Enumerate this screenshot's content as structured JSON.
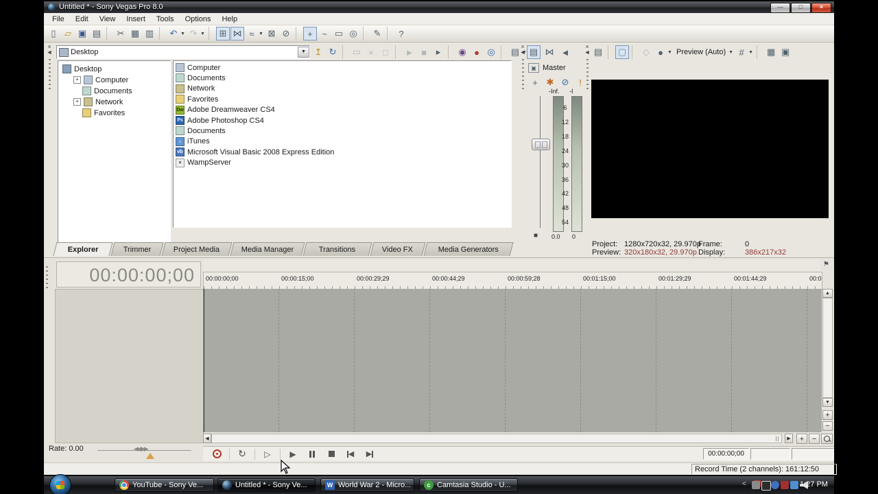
{
  "window": {
    "title": "Untitled * - Sony Vegas Pro 8.0"
  },
  "menu": [
    "File",
    "Edit",
    "View",
    "Insert",
    "Tools",
    "Options",
    "Help"
  ],
  "main_toolbar": [
    {
      "name": "new-project"
    },
    {
      "name": "open"
    },
    {
      "name": "save"
    },
    {
      "name": "project-properties"
    },
    {
      "sep": true
    },
    {
      "name": "cut"
    },
    {
      "name": "copy"
    },
    {
      "name": "paste"
    },
    {
      "sep": true
    },
    {
      "name": "undo",
      "arrow": true
    },
    {
      "name": "redo",
      "arrow": true,
      "disabled": true
    },
    {
      "sep": true
    },
    {
      "name": "enable-snapping",
      "pressed": true
    },
    {
      "name": "automatic-crossfades",
      "pressed": true
    },
    {
      "name": "auto-ripple",
      "arrow": true
    },
    {
      "name": "lock-envelopes"
    },
    {
      "name": "ignore-event-grouping"
    },
    {
      "sep": true
    },
    {
      "name": "normal-edit-tool",
      "pressed": true
    },
    {
      "name": "envelope-edit-tool"
    },
    {
      "name": "selection-edit-tool"
    },
    {
      "name": "zoom-edit-tool"
    },
    {
      "sep": true
    },
    {
      "name": "interactive-tutorials"
    },
    {
      "sep": true
    },
    {
      "name": "whats-this-help"
    }
  ],
  "explorer": {
    "address_value": "Desktop",
    "toolbar": [
      {
        "name": "up-one-level"
      },
      {
        "name": "refresh"
      },
      {
        "sep": true
      },
      {
        "name": "new-folder",
        "disabled": true
      },
      {
        "name": "delete",
        "disabled": true
      },
      {
        "name": "add-to-favorites",
        "disabled": true
      },
      {
        "sep": true
      },
      {
        "name": "start-preview",
        "disabled": true
      },
      {
        "name": "stop-preview",
        "disabled": true
      },
      {
        "name": "auto-preview"
      },
      {
        "sep": true
      },
      {
        "name": "get-media-from-web"
      },
      {
        "name": "media-manager"
      },
      {
        "name": "search-media"
      },
      {
        "sep": true
      },
      {
        "name": "views",
        "arrow": true
      }
    ],
    "tree": [
      {
        "label": "Desktop",
        "level": 0,
        "icon": "desktop",
        "expander": ""
      },
      {
        "label": "Computer",
        "level": 1,
        "icon": "computer",
        "expander": "+"
      },
      {
        "label": "Documents",
        "level": 1,
        "icon": "documents",
        "expander": ""
      },
      {
        "label": "Network",
        "level": 1,
        "icon": "network",
        "expander": "+"
      },
      {
        "label": "Favorites",
        "level": 1,
        "icon": "favorites",
        "expander": ""
      }
    ],
    "files": [
      {
        "label": "Computer",
        "icon": "computer"
      },
      {
        "label": "Documents",
        "icon": "documents"
      },
      {
        "label": "Network",
        "icon": "network"
      },
      {
        "label": "Favorites",
        "icon": "favorites"
      },
      {
        "label": "Adobe Dreamweaver CS4",
        "icon": "dreamweaver"
      },
      {
        "label": "Adobe Photoshop CS4",
        "icon": "photoshop"
      },
      {
        "label": "Documents",
        "icon": "documents"
      },
      {
        "label": "iTunes",
        "icon": "itunes"
      },
      {
        "label": "Microsoft Visual Basic 2008 Express Edition",
        "icon": "visual-basic"
      },
      {
        "label": "WampServer",
        "icon": "wampserver"
      }
    ],
    "tabs": [
      "Explorer",
      "Trimmer",
      "Project Media",
      "Media Manager",
      "Transitions",
      "Video FX",
      "Media Generators"
    ],
    "active_tab": 0
  },
  "mixer": {
    "toolbar": [
      {
        "name": "mixer-properties",
        "pressed": true
      },
      {
        "name": "downmix-output"
      },
      {
        "name": "dim-output"
      }
    ],
    "bus_label": "Master",
    "controls": [
      {
        "name": "insert-fx"
      },
      {
        "name": "bus-settings"
      },
      {
        "name": "mute"
      },
      {
        "name": "solo"
      }
    ],
    "meter": {
      "top_label_left": "-Inf.",
      "top_label_right": "-I",
      "ticks": [
        "6",
        "12",
        "18",
        "24",
        "30",
        "36",
        "42",
        "48",
        "54"
      ],
      "bottom_left": "0.0",
      "bottom_right": "0"
    }
  },
  "preview": {
    "toolbar": [
      {
        "name": "project-video-properties"
      },
      {
        "sep": true
      },
      {
        "name": "external-monitor",
        "pressed": true
      },
      {
        "sep": true
      },
      {
        "name": "video-output-fx",
        "disabled": true
      },
      {
        "name": "preview-quality",
        "arrow": true
      },
      {
        "label": "Preview (Auto)",
        "name": "preview-quality-mode",
        "arrow": true
      },
      {
        "name": "overlays",
        "arrow": true
      },
      {
        "sep": true
      },
      {
        "name": "copy-snapshot"
      },
      {
        "name": "save-snapshot"
      }
    ],
    "mode_label": "Preview (Auto)",
    "status": {
      "project_label": "Project:",
      "project_value": "1280x720x32, 29.970p",
      "frame_label": "Frame:",
      "frame_value": "0",
      "preview_label": "Preview:",
      "preview_value": "320x180x32, 29.970p",
      "display_label": "Display:",
      "display_value": "386x217x32"
    }
  },
  "timeline": {
    "time_display": "00:00:00;00",
    "ruler_labels": [
      "00:00:00;00",
      "00:00:15;00",
      "00:00:29;29",
      "00:00:44;29",
      "00:00:59;28",
      "00:01:15;00",
      "00:01:29;29",
      "00:01:44;29",
      "00:0"
    ],
    "rate_label": "Rate: 0.00",
    "selection_boxes": [
      "00:00:00;00",
      "",
      ""
    ]
  },
  "transport": [
    {
      "name": "record"
    },
    {
      "name": "loop-playback"
    },
    {
      "name": "play-from-start"
    },
    {
      "name": "play"
    },
    {
      "name": "pause"
    },
    {
      "name": "stop"
    },
    {
      "name": "go-to-start"
    },
    {
      "name": "go-to-end"
    }
  ],
  "status_bar": {
    "record_time": "Record Time (2 channels): 161:12:50"
  },
  "taskbar": {
    "overflow_chevron": "»",
    "buttons": [
      {
        "label": "YouTube - Sony Ve...",
        "icon": "chrome-icon",
        "active": false
      },
      {
        "label": "Untitled * - Sony Ve...",
        "icon": "vegas-icon",
        "active": true
      },
      {
        "label": "World War 2 - Micro...",
        "icon": "word-icon",
        "active": false
      },
      {
        "label": "Camtasia Studio - U...",
        "icon": "camtasia-icon",
        "active": false
      }
    ],
    "tray_chevron": "<",
    "tray_icons": [
      "tray-icon-1",
      "tray-icon-2",
      "tray-icon-3",
      "tray-icon-4",
      "tray-icon-5",
      "tray-icon-6"
    ],
    "clock": "1:27 PM"
  },
  "colors": {
    "maroon_status_text": "#8e3b3b",
    "track_area_gray": "#a9aaa3",
    "taskbar_black": "#0e1012",
    "record_red": "#b03a2a",
    "marker_yellow": "#e8c531"
  }
}
